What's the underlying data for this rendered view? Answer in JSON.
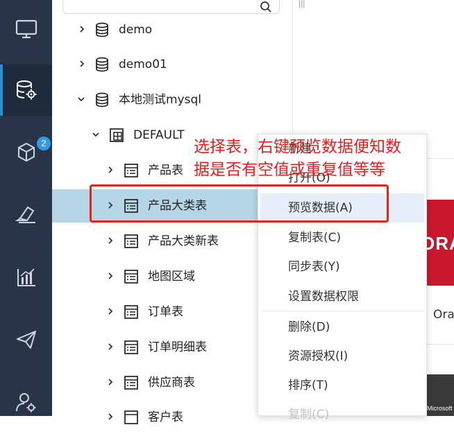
{
  "sidebar": {
    "items": [
      {
        "icon": "monitor-icon"
      },
      {
        "icon": "database-settings-icon",
        "active": true
      },
      {
        "icon": "cube-icon",
        "badge": "2"
      },
      {
        "icon": "eraser-icon"
      },
      {
        "icon": "bar-chart-icon"
      },
      {
        "icon": "send-icon"
      },
      {
        "icon": "user-settings-icon"
      }
    ]
  },
  "search": {
    "placeholder": ""
  },
  "tree": {
    "items": [
      {
        "label": "demo",
        "type": "database",
        "expanded": false
      },
      {
        "label": "demo01",
        "type": "database",
        "expanded": false
      },
      {
        "label": "本地测试mysql",
        "type": "database",
        "expanded": true
      },
      {
        "label": "DEFAULT",
        "type": "schema",
        "expanded": true
      },
      {
        "label": "产品表",
        "type": "table",
        "expanded": false
      },
      {
        "label": "产品大类表",
        "type": "table",
        "expanded": false,
        "selected": true
      },
      {
        "label": "产品大类新表",
        "type": "table",
        "expanded": false
      },
      {
        "label": "地图区域",
        "type": "table",
        "expanded": false
      },
      {
        "label": "订单表",
        "type": "table",
        "expanded": false
      },
      {
        "label": "订单明细表",
        "type": "table",
        "expanded": false
      },
      {
        "label": "供应商表",
        "type": "table",
        "expanded": false
      },
      {
        "label": "客户表",
        "type": "table",
        "expanded": false
      }
    ]
  },
  "context_menu": {
    "items": [
      {
        "label": "新建"
      },
      {
        "label": "打开(O)"
      },
      {
        "label": "预览数据(A)",
        "hover": true
      },
      {
        "label": "复制表(C)"
      },
      {
        "label": "同步表(Y)"
      },
      {
        "label": "设置数据权限"
      },
      {
        "label": "删除(D)"
      },
      {
        "label": "资源授权(I)"
      },
      {
        "label": "排序(T)"
      },
      {
        "label": "复制(C)",
        "disabled": true
      }
    ]
  },
  "annotation": {
    "line1": "选择表，右键预览数据便知数",
    "line2": "据是否有空值或重复值等等",
    "color": "#ee1c1c"
  },
  "right_panel": {
    "top_mark": "|||",
    "banner_text": "ORA",
    "label": "Ora",
    "ms_text": "Microsoft"
  },
  "colors": {
    "sidebar_bg": "#283447",
    "accent": "#2b8fd6",
    "selected_row": "#b4d6e6",
    "menu_hover": "#e5eef9",
    "highlight": "#e8211a"
  }
}
